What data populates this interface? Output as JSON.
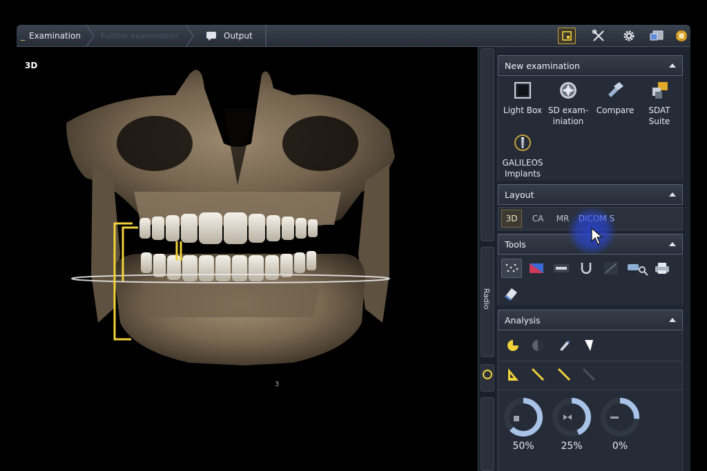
{
  "tabs": {
    "examination": "Examination",
    "second": "Further examination",
    "output": "Output"
  },
  "viewport": {
    "label": "3D",
    "small_label": "3"
  },
  "strip": {
    "text": "Radio"
  },
  "sections": {
    "new_examination": "New examination",
    "layout": "Layout",
    "tools": "Tools",
    "analysis": "Analysis"
  },
  "tiles": [
    {
      "label": "Light Box"
    },
    {
      "label": "SD exam-\niniation"
    },
    {
      "label": "Compare"
    },
    {
      "label": "SDAT\nSuite"
    },
    {
      "label": "GALILEOS\nImplants"
    }
  ],
  "layout_buttons": [
    "3D",
    "CA",
    "MR",
    "DICOM S"
  ],
  "analysis_rings": [
    {
      "label": "50%",
      "value": 0.5
    },
    {
      "label": "25%",
      "value": 0.25
    },
    {
      "label": "0%",
      "value": 0.0
    }
  ],
  "colors": {
    "accent_yellow": "#f2d23a",
    "ring_blue": "#5d8bd6",
    "cursor_glow": "#2846e6"
  }
}
